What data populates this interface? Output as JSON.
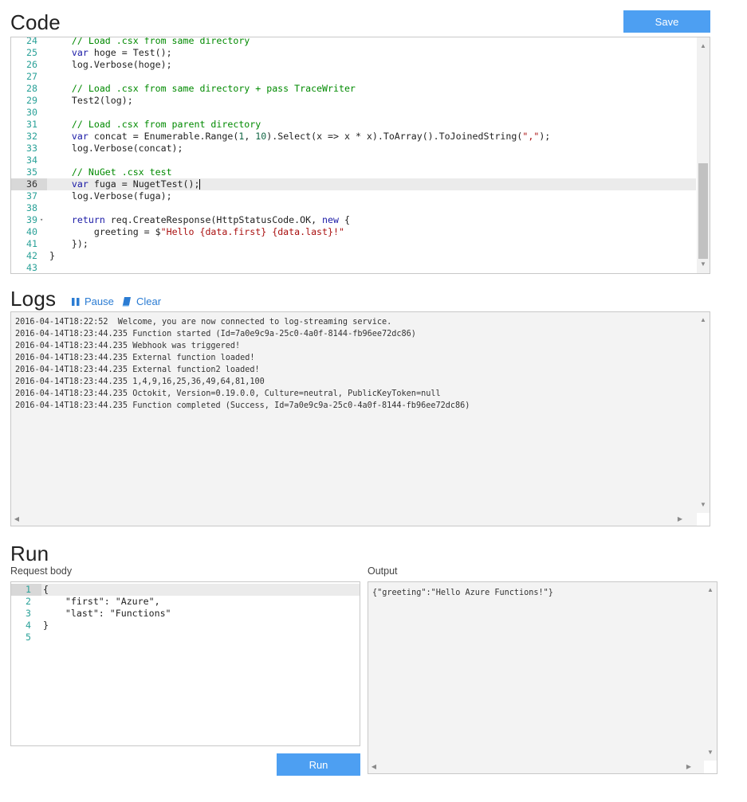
{
  "code_section": {
    "title": "Code",
    "save_label": "Save",
    "lines": [
      {
        "n": "24",
        "html": "    <span class=\"cm\">// Load .csx from same directory</span>"
      },
      {
        "n": "25",
        "html": "    <span class=\"kw\">var</span> hoge = Test();"
      },
      {
        "n": "26",
        "html": "    log.Verbose(hoge);"
      },
      {
        "n": "27",
        "html": ""
      },
      {
        "n": "28",
        "html": "    <span class=\"cm\">// Load .csx from same directory + pass TraceWriter</span>"
      },
      {
        "n": "29",
        "html": "    Test2(log);"
      },
      {
        "n": "30",
        "html": ""
      },
      {
        "n": "31",
        "html": "    <span class=\"cm\">// Load .csx from parent directory</span>"
      },
      {
        "n": "32",
        "html": "    <span class=\"kw\">var</span> concat = Enumerable.Range(<span class=\"nm\">1</span>, <span class=\"nm\">10</span>).Select(x => x * x).ToArray().ToJoinedString(<span class=\"st\">\",\"</span>);"
      },
      {
        "n": "33",
        "html": "    log.Verbose(concat);"
      },
      {
        "n": "34",
        "html": ""
      },
      {
        "n": "35",
        "html": "    <span class=\"cm\">// NuGet .csx test</span>"
      },
      {
        "n": "36",
        "html": "    <span class=\"kw\">var</span> fuga = NugetTest();"
      },
      {
        "n": "37",
        "html": "    log.Verbose(fuga);"
      },
      {
        "n": "38",
        "html": ""
      },
      {
        "n": "39",
        "html": "    <span class=\"kw\">return</span> req.CreateResponse(HttpStatusCode.OK, <span class=\"kw\">new</span> {"
      },
      {
        "n": "40",
        "html": "        greeting = $<span class=\"st\">\"Hello {data.first} {data.last}!\"</span>"
      },
      {
        "n": "41",
        "html": "    });"
      },
      {
        "n": "42",
        "html": "}"
      },
      {
        "n": "43",
        "html": ""
      }
    ],
    "active_line": "36",
    "fold_line": "39"
  },
  "logs_section": {
    "title": "Logs",
    "pause_label": "Pause",
    "clear_label": "Clear",
    "lines": [
      "2016-04-14T18:22:52  Welcome, you are now connected to log-streaming service.",
      "2016-04-14T18:23:44.235 Function started (Id=7a0e9c9a-25c0-4a0f-8144-fb96ee72dc86)",
      "2016-04-14T18:23:44.235 Webhook was triggered!",
      "2016-04-14T18:23:44.235 External function loaded!",
      "2016-04-14T18:23:44.235 External function2 loaded!",
      "2016-04-14T18:23:44.235 1,4,9,16,25,36,49,64,81,100",
      "2016-04-14T18:23:44.235 Octokit, Version=0.19.0.0, Culture=neutral, PublicKeyToken=null",
      "2016-04-14T18:23:44.235 Function completed (Success, Id=7a0e9c9a-25c0-4a0f-8144-fb96ee72dc86)"
    ]
  },
  "run_section": {
    "title": "Run",
    "request_label": "Request body",
    "output_label": "Output",
    "run_label": "Run",
    "request_lines": [
      {
        "n": "1",
        "text": "{"
      },
      {
        "n": "2",
        "text": "    \"first\": \"Azure\","
      },
      {
        "n": "3",
        "text": "    \"last\": \"Functions\""
      },
      {
        "n": "4",
        "text": "}"
      },
      {
        "n": "5",
        "text": ""
      }
    ],
    "output_text": "{\"greeting\":\"Hello Azure Functions!\"}"
  },
  "colors": {
    "accent": "#4d9ff2",
    "link": "#2b7cd3",
    "comment": "#008a00",
    "keyword": "#1a1aa6",
    "line_number": "#2aa198"
  }
}
